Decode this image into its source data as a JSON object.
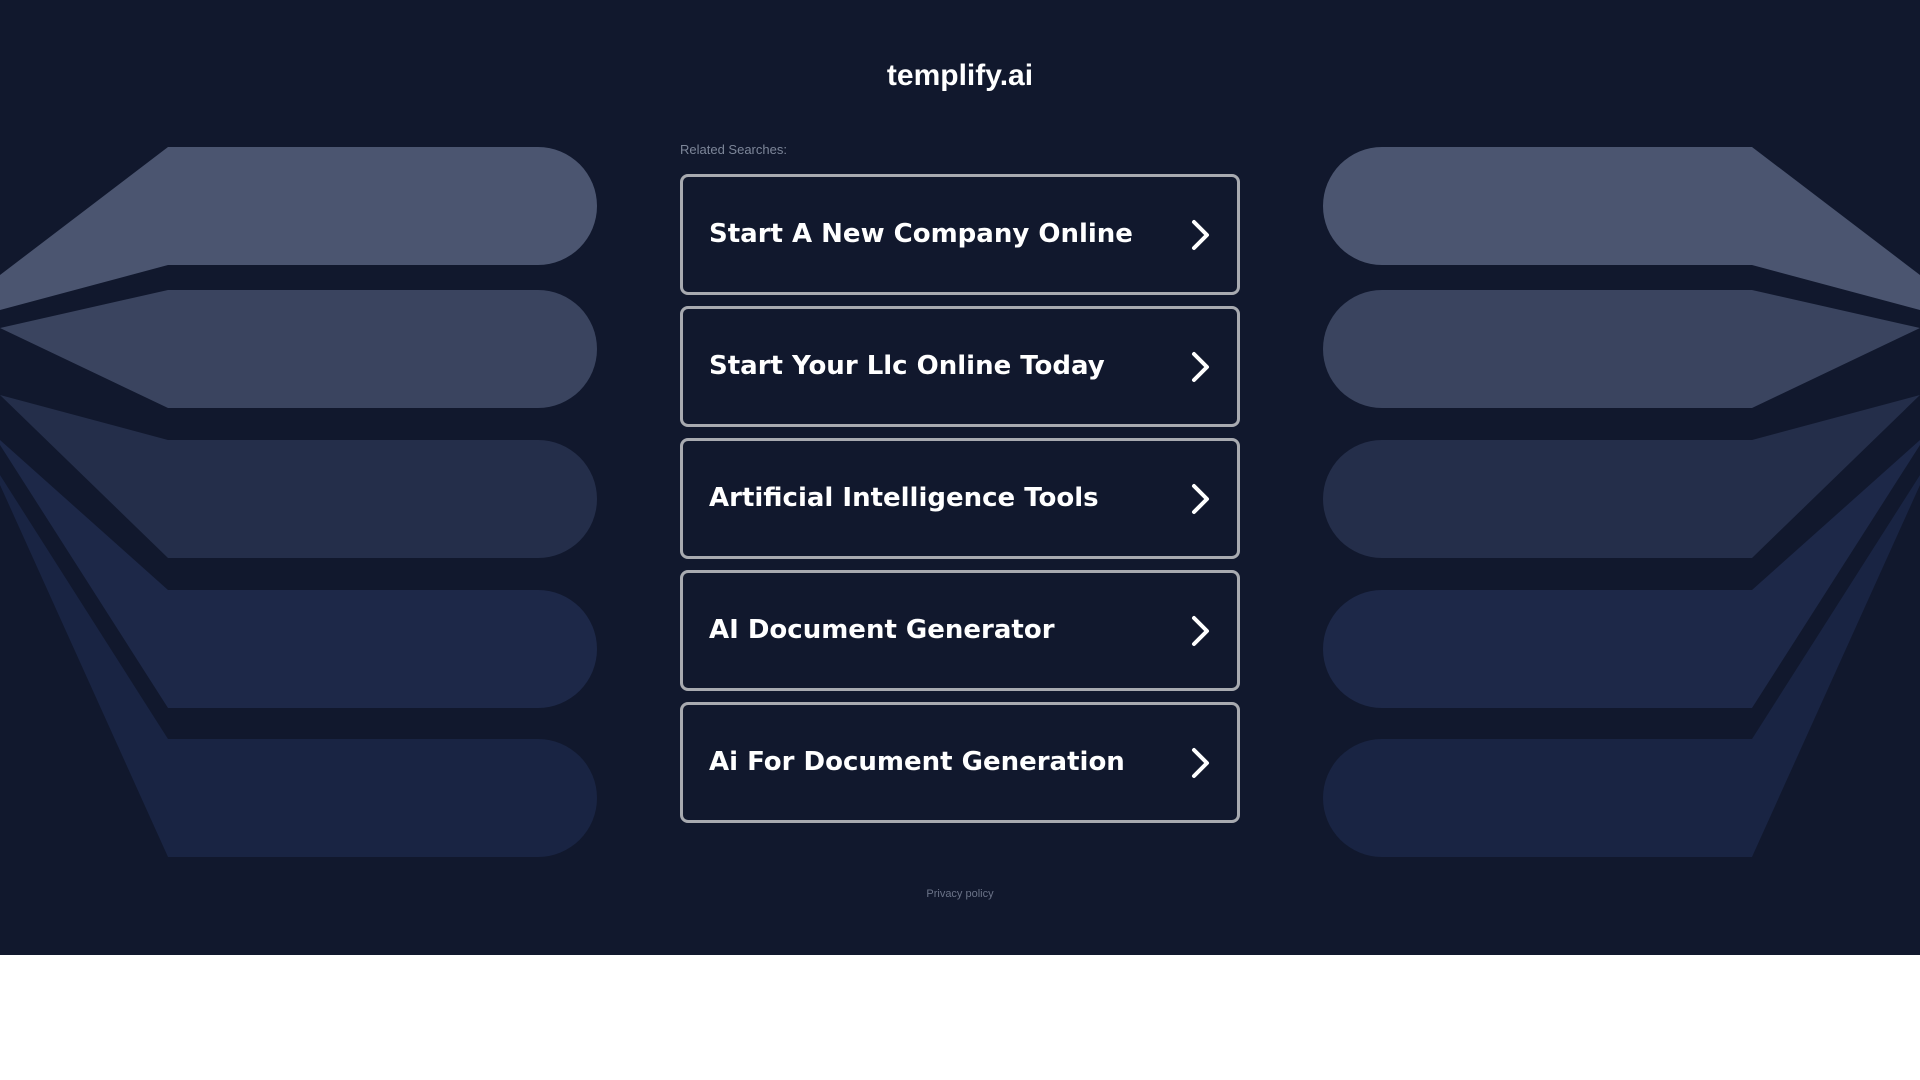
{
  "header": {
    "domain": "templify.ai"
  },
  "related": {
    "label": "Related Searches:",
    "items": [
      {
        "label": "Start A New Company Online"
      },
      {
        "label": "Start Your Llc Online Today"
      },
      {
        "label": "Artificial Intelligence Tools"
      },
      {
        "label": "AI Document Generator"
      },
      {
        "label": "Ai For Document Generation"
      }
    ]
  },
  "footer": {
    "privacy_label": "Privacy policy"
  },
  "colors": {
    "background": "#11182d",
    "box_border": "#a8aab0",
    "band_1": "#4b5570",
    "band_2": "#3a445f",
    "band_3": "#242e4a",
    "band_4": "#1d2848",
    "band_5": "#192443"
  },
  "icons": {
    "link_arrow": "chevron-right-icon"
  }
}
